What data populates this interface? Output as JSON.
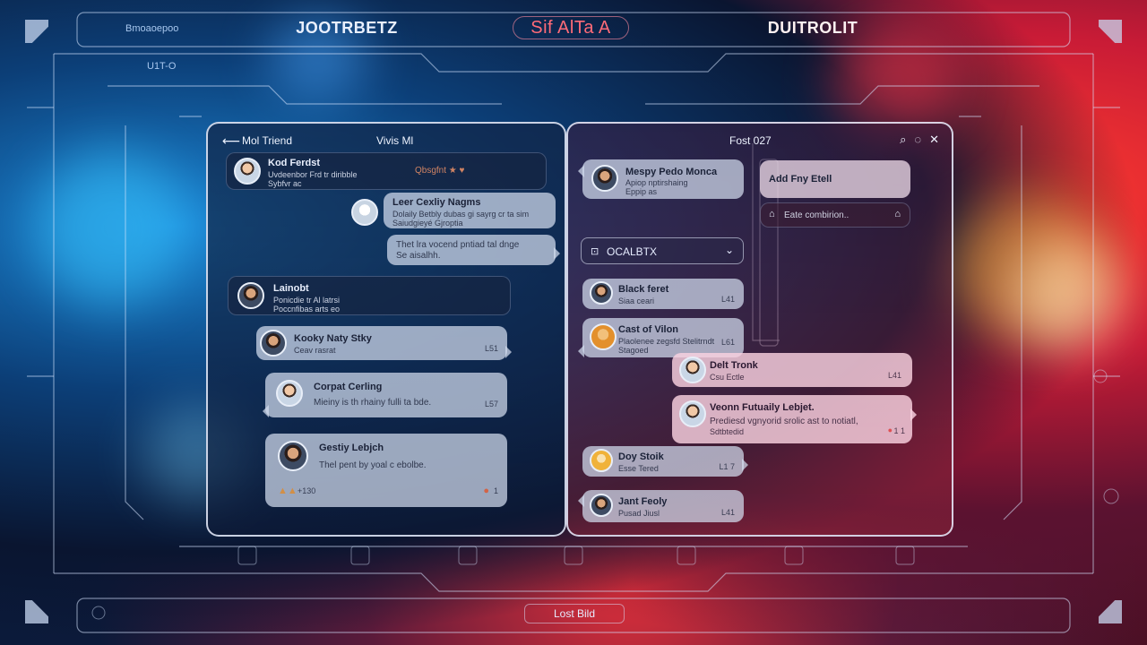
{
  "header": {
    "left_label": "JOOTRBETZ",
    "center_label": "Sif AlTa A",
    "right_label": "DUITROLIT",
    "small_left": "Bmoaoepoo",
    "side_small": "U1T-O"
  },
  "footer": {
    "center_label": "Lost Bild"
  },
  "left_panel": {
    "back_icon": "back-arrow-icon",
    "title": "Mol Triend",
    "center_title": "Vivis Ml",
    "items": [
      {
        "name": "Kod Ferdst",
        "sub": "Uvdeenbor Frd tr diribble",
        "sub2": "Sybfvr ac",
        "tag": "Qbsgfnt ★ ♥",
        "style": "dark"
      },
      {
        "name": "Leer Cexliy Nagms",
        "sub": "Dolaily Betbly dubas gi sayrg cr ta sim",
        "sub2": "Saiudgieyé Gjroptia",
        "style": "light"
      },
      {
        "text": "Thet lra vocend pntiad tal dnge",
        "text2": "Se aisalhh.",
        "style": "light"
      },
      {
        "name": "Lainobt",
        "sub": "Ponicdie tr Al latrsi",
        "sub2": "Poccnfibas arts eo",
        "style": "dark"
      },
      {
        "name": "Kooky Naty Stky",
        "sub": "Ceav rasrat",
        "meta": "L51",
        "style": "light"
      },
      {
        "name": "Corpat Cerling",
        "sub": "Mieiny is th rhainy fulli ta bde.",
        "meta": "L57",
        "style": "light"
      },
      {
        "name": "Gestiy Lebjch",
        "sub": "Thel pent by yoal c ebolbe.",
        "meta": "+130",
        "meta2": "1",
        "style": "light"
      }
    ]
  },
  "right_panel": {
    "center_title": "Fost 027",
    "icons": [
      "search-icon",
      "record-icon",
      "close-icon"
    ],
    "items": [
      {
        "name": "Mespy Pedo Monca",
        "sub": "Apiop nptirshaing",
        "sub2": "Eppip as",
        "style": "light"
      },
      {
        "name": "Black feret",
        "sub": "Siaa ceari",
        "meta": "L41",
        "style": "light"
      },
      {
        "name": "Cast of Vilon",
        "sub": "Plaolenee zegsfd Stelitrndt",
        "sub2": "Stagoed",
        "meta": "L61",
        "style": "light"
      },
      {
        "name": "Delt Tronk",
        "sub": "Csu Ectle",
        "meta": "L41",
        "style": "pink"
      },
      {
        "name": "Veonn Futuaily Lebjet.",
        "sub": "Prediesd vgnyorid srolic ast to notiatl,",
        "sub2": "Sdtbtedid",
        "meta": "1 1",
        "style": "pink"
      },
      {
        "name": "Doy Stoik",
        "sub": "Esse Tered",
        "meta": "L1 7",
        "style": "light"
      },
      {
        "name": "Jant Feoly",
        "sub": "Pusad Jiusl",
        "meta": "L41",
        "style": "light"
      }
    ],
    "dropdown_label": "OCALBTX",
    "side_cards": [
      {
        "label": "Add Fny Etell"
      },
      {
        "label": "Eate combirion.."
      }
    ]
  }
}
